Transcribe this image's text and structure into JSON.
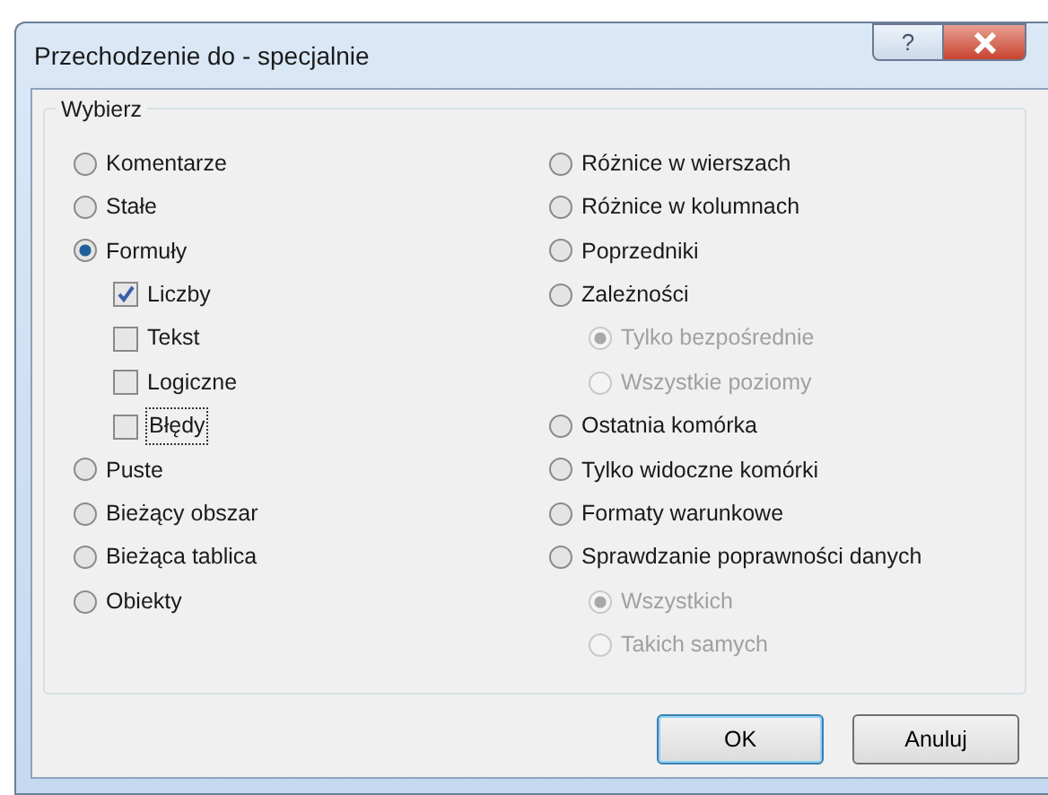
{
  "window": {
    "title": "Przechodzenie do - specjalnie",
    "help_button": "?"
  },
  "group": {
    "title": "Wybierz",
    "columns": [
      [
        {
          "kind": "radio",
          "label": "Komentarze",
          "selected": false,
          "disabled": false
        },
        {
          "kind": "radio",
          "label": "Stałe",
          "selected": false,
          "disabled": false
        },
        {
          "kind": "radio",
          "label": "Formuły",
          "selected": true,
          "disabled": false,
          "children": [
            {
              "kind": "checkbox",
              "label": "Liczby",
              "checked": true,
              "disabled": false,
              "focused": false
            },
            {
              "kind": "checkbox",
              "label": "Tekst",
              "checked": false,
              "disabled": false,
              "focused": false
            },
            {
              "kind": "checkbox",
              "label": "Logiczne",
              "checked": false,
              "disabled": false,
              "focused": false
            },
            {
              "kind": "checkbox",
              "label": "Błędy",
              "checked": false,
              "disabled": false,
              "focused": true
            }
          ]
        },
        {
          "kind": "radio",
          "label": "Puste",
          "selected": false,
          "disabled": false
        },
        {
          "kind": "radio",
          "label": "Bieżący obszar",
          "selected": false,
          "disabled": false
        },
        {
          "kind": "radio",
          "label": "Bieżąca tablica",
          "selected": false,
          "disabled": false
        },
        {
          "kind": "radio",
          "label": "Obiekty",
          "selected": false,
          "disabled": false
        }
      ],
      [
        {
          "kind": "radio",
          "label": "Różnice w wierszach",
          "selected": false,
          "disabled": false
        },
        {
          "kind": "radio",
          "label": "Różnice w kolumnach",
          "selected": false,
          "disabled": false
        },
        {
          "kind": "radio",
          "label": "Poprzedniki",
          "selected": false,
          "disabled": false
        },
        {
          "kind": "radio",
          "label": "Zależności",
          "selected": false,
          "disabled": false,
          "children": [
            {
              "kind": "radio",
              "label": "Tylko bezpośrednie",
              "selected": true,
              "disabled": true
            },
            {
              "kind": "radio",
              "label": "Wszystkie poziomy",
              "selected": false,
              "disabled": true
            }
          ]
        },
        {
          "kind": "radio",
          "label": "Ostatnia komórka",
          "selected": false,
          "disabled": false
        },
        {
          "kind": "radio",
          "label": "Tylko widoczne komórki",
          "selected": false,
          "disabled": false
        },
        {
          "kind": "radio",
          "label": "Formaty warunkowe",
          "selected": false,
          "disabled": false
        },
        {
          "kind": "radio",
          "label": "Sprawdzanie poprawności danych",
          "selected": false,
          "disabled": false,
          "children": [
            {
              "kind": "radio",
              "label": "Wszystkich",
              "selected": true,
              "disabled": true
            },
            {
              "kind": "radio",
              "label": "Takich samych",
              "selected": false,
              "disabled": true
            }
          ]
        }
      ]
    ]
  },
  "buttons": [
    {
      "label": "OK",
      "default": true
    },
    {
      "label": "Anuluj",
      "default": false
    }
  ]
}
